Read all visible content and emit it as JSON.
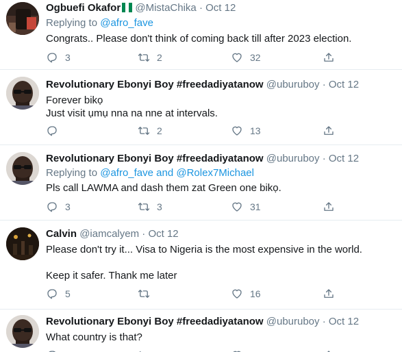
{
  "tweets": [
    {
      "name": "Ogbuefi Okafor",
      "handle": "@MistaChika",
      "time": "Oct 12",
      "reply_prefix": "Replying to ",
      "mentions": [
        "@afro_fave"
      ],
      "text": "Congrats.. Please don't think of coming back till after 2023 election.",
      "replies": "3",
      "retweets": "2",
      "likes": "32"
    },
    {
      "name": "Revolutionary Ebonyi Boy #freedadiyatanow",
      "handle": "@uburuboy",
      "time": "Oct 12",
      "text": "Forever bikọ\nJust visit ụmụ nna na nne at intervals.",
      "replies": "",
      "retweets": "2",
      "likes": "13"
    },
    {
      "name": "Revolutionary Ebonyi Boy #freedadiyatanow",
      "handle": "@uburuboy",
      "time": "Oct 12",
      "reply_prefix": "Replying to ",
      "mentions": [
        "@afro_fave",
        "@Rolex7Michael"
      ],
      "mention_joiner": " and ",
      "text": "Pls call LAWMA and dash them zat Green one bikọ.",
      "replies": "3",
      "retweets": "3",
      "likes": "31"
    },
    {
      "name": "Calvin",
      "handle": "@iamcalyem",
      "time": "Oct 12",
      "text": "Please don't try it... Visa to Nigeria is the most expensive in the world.\n\nKeep it safer. Thank me later",
      "replies": "5",
      "retweets": "",
      "likes": "16"
    },
    {
      "name": "Revolutionary Ebonyi Boy #freedadiyatanow",
      "handle": "@uburuboy",
      "time": "Oct 12",
      "text": "What country is that?",
      "replies": "",
      "retweets": "",
      "likes": ""
    }
  ],
  "separator": "·",
  "icons": {
    "reply": "reply-icon",
    "retweet": "retweet-icon",
    "like": "heart-icon",
    "share": "share-icon",
    "flag": "nigeria-flag-icon"
  },
  "colors": {
    "link": "#1b95e0",
    "secondary": "#657786",
    "text": "#14171a",
    "border": "#e6ecf0",
    "flag_green": "#008751"
  }
}
